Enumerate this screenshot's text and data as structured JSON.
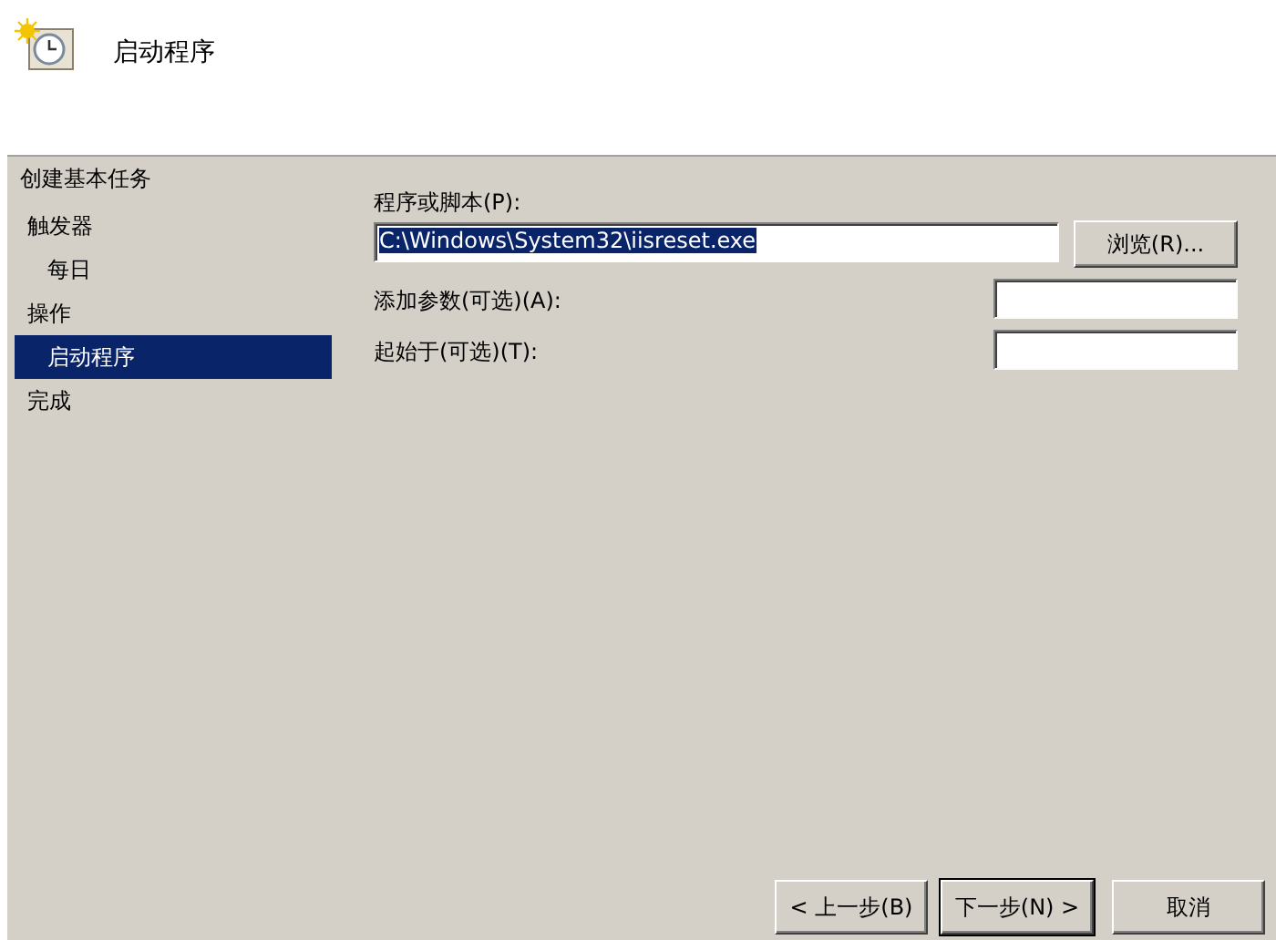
{
  "header": {
    "title": "启动程序"
  },
  "steps": {
    "heading": "创建基本任务",
    "items": [
      {
        "label": "触发器",
        "selected": false,
        "children": [
          {
            "label": "每日",
            "selected": false
          }
        ]
      },
      {
        "label": "操作",
        "selected": false,
        "children": [
          {
            "label": "启动程序",
            "selected": true
          }
        ]
      },
      {
        "label": "完成",
        "selected": false
      }
    ]
  },
  "form": {
    "program_label": "程序或脚本(P):",
    "program_value": "C:\\Windows\\System32\\iisreset.exe",
    "browse_button": "浏览(R)...",
    "args_label": "添加参数(可选)(A):",
    "start_label": "起始于(可选)(T):"
  },
  "buttons": [
    {
      "label": "< 上一步(B)",
      "default": false
    },
    {
      "label": "下一步(N) >",
      "default": true
    },
    {
      "label": "取消",
      "default": false
    }
  ]
}
